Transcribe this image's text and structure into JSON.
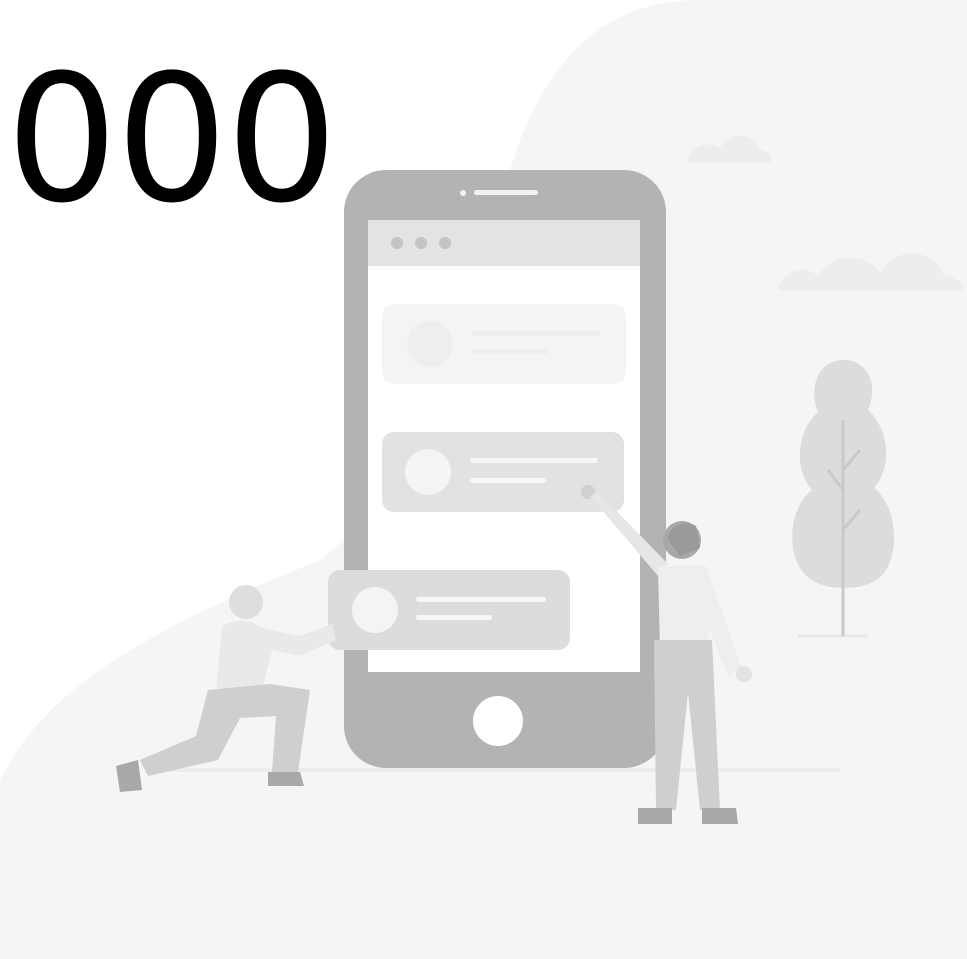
{
  "headline": {
    "text": ",000"
  },
  "colors": {
    "background": "#ffffff",
    "blob": "#f5f5f5",
    "phone_body": "#b3b3b3",
    "phone_screen": "#ffffff",
    "phone_topbar": "#e3e3e3",
    "card_faint": "#f4f4f4",
    "card": "#e2e2e2",
    "card_dark": "#dcdcdc",
    "figure_light": "#e9e9e9",
    "figure_mid": "#cfcfcf",
    "figure_dark": "#a8a8a8",
    "tree": "#dcdcdc"
  },
  "icons": {
    "phone": "smartphone-illustration",
    "tree": "tree-icon",
    "clouds": "cloud-icon",
    "people": "person-figure"
  }
}
